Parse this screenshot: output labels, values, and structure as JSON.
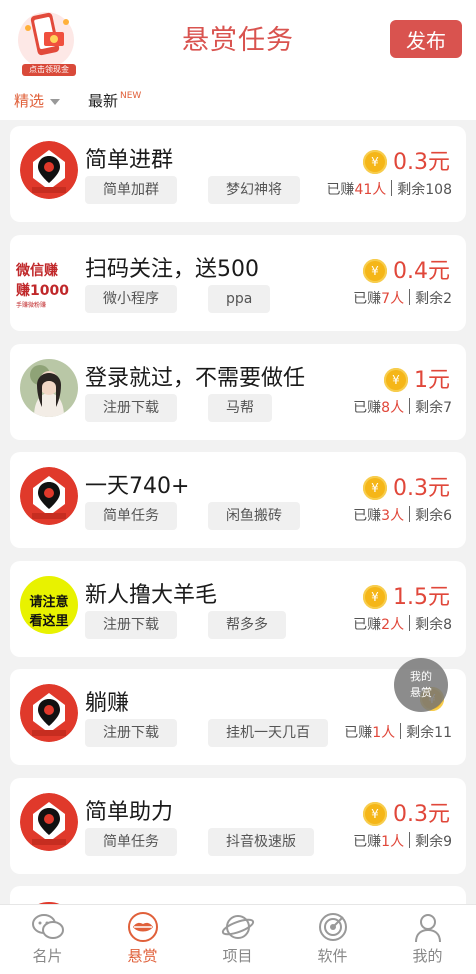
{
  "header": {
    "title": "悬赏任务",
    "publish_label": "发布",
    "promo_caption": "点击领现金"
  },
  "filters": {
    "selected_label": "精选",
    "latest_label": "最新",
    "new_tag": "NEW"
  },
  "tasks": [
    {
      "title": "简单进群",
      "tags": [
        "简单加群",
        "梦幻神将"
      ],
      "reward": "0.3元",
      "earned_prefix": "已赚",
      "earned": "41人",
      "remaining": "剩余108",
      "avatar": "logo-red"
    },
    {
      "title": "扫码关注，送500",
      "tags": [
        "微小程序",
        "ppa"
      ],
      "reward": "0.4元",
      "earned_prefix": "已赚",
      "earned": "7人",
      "remaining": "剩余2",
      "avatar": "text-promo",
      "avatar_text_1": "微信赚",
      "avatar_text_2": "赚1000",
      "avatar_text_3": "手赚微粉赚"
    },
    {
      "title": "登录就过，不需要做任",
      "tags": [
        "注册下载",
        "马帮"
      ],
      "reward": "1元",
      "earned_prefix": "已赚",
      "earned": "8人",
      "remaining": "剩余7",
      "avatar": "photo"
    },
    {
      "title": "一天740+",
      "tags": [
        "简单任务",
        "闲鱼搬砖"
      ],
      "reward": "0.3元",
      "earned_prefix": "已赚",
      "earned": "3人",
      "remaining": "剩余6",
      "avatar": "logo-red"
    },
    {
      "title": "新人撸大羊毛",
      "tags": [
        "注册下载",
        "帮多多"
      ],
      "reward": "1.5元",
      "earned_prefix": "已赚",
      "earned": "2人",
      "remaining": "剩余8",
      "avatar": "yellow-notice",
      "avatar_text_1": "请注意",
      "avatar_text_2": "看这里"
    },
    {
      "title": "躺赚",
      "tags": [
        "注册下载",
        "挂机一天几百"
      ],
      "reward": "",
      "earned_prefix": "已赚",
      "earned": "1人",
      "remaining": "剩余11",
      "avatar": "logo-red"
    },
    {
      "title": "简单助力",
      "tags": [
        "简单任务",
        "抖音极速版"
      ],
      "reward": "0.3元",
      "earned_prefix": "已赚",
      "earned": "1人",
      "remaining": "剩余9",
      "avatar": "logo-red"
    }
  ],
  "coin_symbol": "¥",
  "floating_button": {
    "line1": "我的",
    "line2": "悬赏"
  },
  "bottom_nav": [
    {
      "label": "名片",
      "icon": "chat-bubble-icon",
      "active": false
    },
    {
      "label": "悬赏",
      "icon": "lips-icon",
      "active": true
    },
    {
      "label": "项目",
      "icon": "planet-icon",
      "active": false
    },
    {
      "label": "软件",
      "icon": "radar-icon",
      "active": false
    },
    {
      "label": "我的",
      "icon": "person-icon",
      "active": false
    }
  ],
  "colors": {
    "accent": "#d9534f",
    "reward": "#e0473a",
    "coin": "#f5b618"
  }
}
